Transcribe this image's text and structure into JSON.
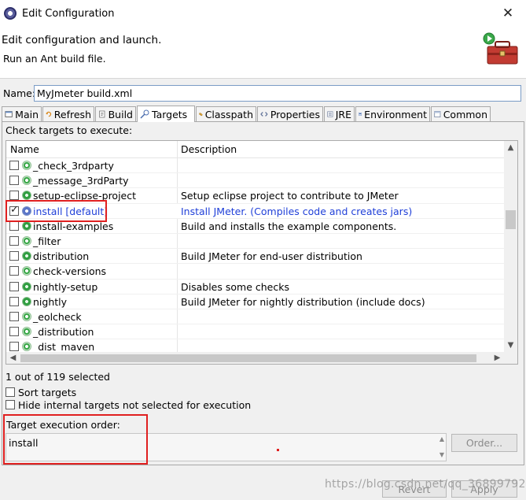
{
  "window": {
    "title": "Edit Configuration",
    "close_glyph": "✕"
  },
  "header": {
    "title": "Edit configuration and launch.",
    "subtitle": "Run an Ant build file.",
    "icon": "toolbox-icon"
  },
  "name_field": {
    "label": "Name:",
    "value": "MyJmeter build.xml"
  },
  "tabs": [
    {
      "label": "Main",
      "icon": "main-icon"
    },
    {
      "label": "Refresh",
      "icon": "refresh-icon"
    },
    {
      "label": "Build",
      "icon": "build-icon"
    },
    {
      "label": "Targets",
      "icon": "targets-icon",
      "active": true
    },
    {
      "label": "Classpath",
      "icon": "classpath-icon"
    },
    {
      "label": "Properties",
      "icon": "properties-icon"
    },
    {
      "label": "JRE",
      "icon": "jre-icon"
    },
    {
      "label": "Environment",
      "icon": "environment-icon"
    },
    {
      "label": "Common",
      "icon": "common-icon"
    }
  ],
  "targets": {
    "check_label": "Check targets to execute:",
    "columns": {
      "name": "Name",
      "description": "Description"
    },
    "rows": [
      {
        "name": "_check_3rdparty",
        "description": "",
        "checked": false
      },
      {
        "name": "_message_3rdParty",
        "description": "",
        "checked": false
      },
      {
        "name": "setup-eclipse-project",
        "description": "Setup eclipse project to contribute to JMeter",
        "checked": false
      },
      {
        "name": "install [default]",
        "description": "Install JMeter. (Compiles code and creates jars)",
        "checked": true
      },
      {
        "name": "install-examples",
        "description": "Build and installs the example components.",
        "checked": false
      },
      {
        "name": "_filter",
        "description": "",
        "checked": false
      },
      {
        "name": "distribution",
        "description": "Build JMeter for end-user distribution",
        "checked": false
      },
      {
        "name": "check-versions",
        "description": "",
        "checked": false
      },
      {
        "name": "nightly-setup",
        "description": "Disables some checks",
        "checked": false
      },
      {
        "name": "nightly",
        "description": "Build JMeter for nightly distribution (include docs)",
        "checked": false
      },
      {
        "name": "_eolcheck",
        "description": "",
        "checked": false
      },
      {
        "name": "_distribution",
        "description": "",
        "checked": false
      },
      {
        "name": "_dist_maven",
        "description": "",
        "checked": false
      }
    ],
    "selected_count": "1 out of 119 selected",
    "sort_label": "Sort targets",
    "hide_label": "Hide internal targets not selected for execution"
  },
  "order": {
    "label": "Target execution order:",
    "value": "install",
    "button": "Order..."
  },
  "footer": {
    "revert": "Revert",
    "apply": "Apply"
  },
  "watermark": "https://blog.csdn.net/qq_36899792",
  "colors": {
    "selected_text": "#1f3fd8",
    "annotation_red": "#e02020",
    "target_green": "#3ba84a"
  }
}
